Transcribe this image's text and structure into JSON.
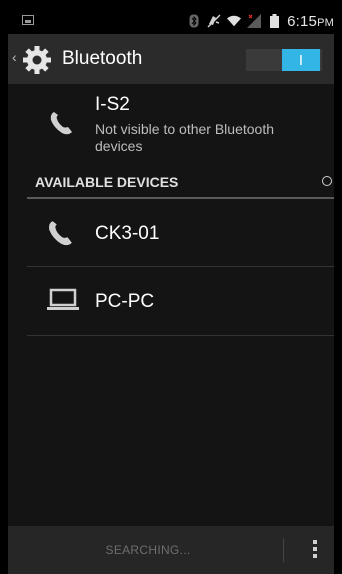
{
  "status_bar": {
    "time": "6:15",
    "ampm": "PM",
    "icons": [
      "notification-icon",
      "bluetooth-icon",
      "vibrate-off-icon",
      "wifi-icon",
      "signal-icon",
      "battery-icon"
    ]
  },
  "action_bar": {
    "title": "Bluetooth",
    "toggle_label": "I",
    "toggle_on": true,
    "accent": "#33b5e5"
  },
  "self_device": {
    "name": "I-S2",
    "subtitle": "Not visible to other Bluetooth devices",
    "icon": "phone-icon"
  },
  "available_section": {
    "title": "AVAILABLE DEVICES"
  },
  "devices": [
    {
      "name": "CK3-01",
      "icon": "phone-icon"
    },
    {
      "name": "PC-PC",
      "icon": "laptop-icon"
    }
  ],
  "bottom_bar": {
    "status": "SEARCHING..."
  }
}
